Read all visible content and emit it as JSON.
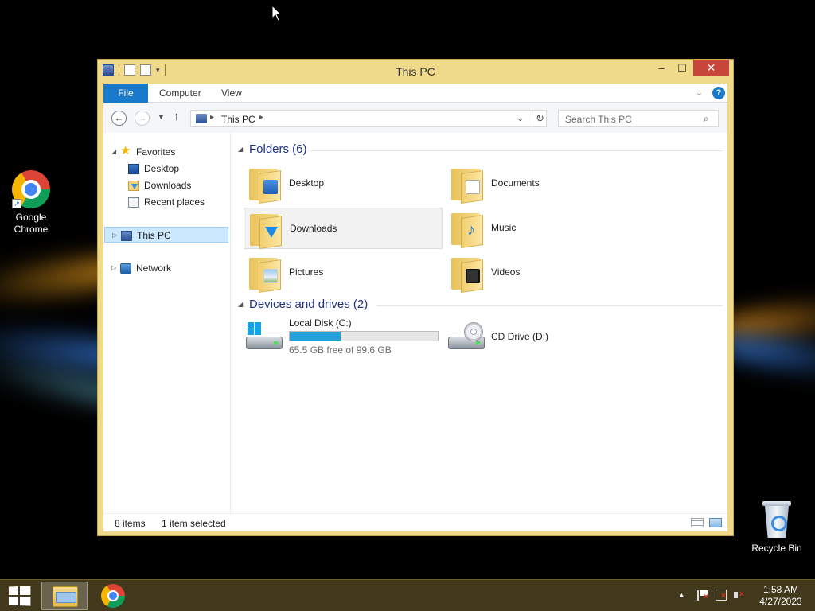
{
  "desktop": {
    "icons": [
      {
        "label_line1": "Google",
        "label_line2": "Chrome"
      },
      {
        "label": "Recycle Bin"
      }
    ]
  },
  "window": {
    "title": "This PC",
    "controls": {
      "minimize": "–",
      "maximize": "☐",
      "close": "✕"
    }
  },
  "ribbon": {
    "tabs": [
      "File",
      "Computer",
      "View"
    ],
    "help": "?"
  },
  "address": {
    "path": "This PC",
    "search_placeholder": "Search This PC"
  },
  "navpane": {
    "favorites": "Favorites",
    "favorites_items": [
      "Desktop",
      "Downloads",
      "Recent places"
    ],
    "this_pc": "This PC",
    "network": "Network"
  },
  "content": {
    "folders_header": "Folders (6)",
    "folders": [
      "Desktop",
      "Documents",
      "Downloads",
      "Music",
      "Pictures",
      "Videos"
    ],
    "selected_folder": "Downloads",
    "devices_header": "Devices and drives (2)",
    "drives": [
      {
        "name": "Local Disk (C:)",
        "free": "65.5 GB free of 99.6 GB",
        "used_fraction": 0.342
      },
      {
        "name": "CD Drive (D:)"
      }
    ]
  },
  "status": {
    "items": "8 items",
    "selected": "1 item selected"
  },
  "taskbar": {
    "time": "1:58 AM",
    "date": "4/27/2023"
  },
  "colors": {
    "title_bar": "#efd98a",
    "file_tab": "#1979ca",
    "close_button": "#c7453a",
    "progress_fill": "#26a0da",
    "selection": "#cce8ff"
  }
}
